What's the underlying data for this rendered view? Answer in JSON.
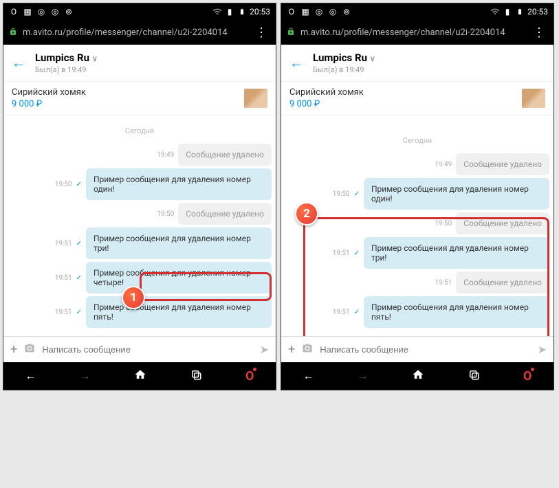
{
  "status": {
    "time": "20:53"
  },
  "browser": {
    "url": "m.avito.ru/profile/messenger/channel/u2i-2204014"
  },
  "header": {
    "contact_name": "Lumpics Ru",
    "last_seen": "Был(а) в 19:49"
  },
  "listing": {
    "title": "Сирийский хомяк",
    "price": "9 000 ₽"
  },
  "chat": {
    "date_label": "Сегодня",
    "deleted_text": "Сообщение удалено",
    "left_messages": [
      {
        "time": "19:49",
        "deleted": true
      },
      {
        "time": "19:50",
        "text": "Пример сообщения для удаления номер один!",
        "check": true
      },
      {
        "time": "19:50",
        "deleted": true
      },
      {
        "time": "19:51",
        "text": "Пример сообщения для удаления номер три!",
        "check": true
      },
      {
        "time": "19:51",
        "text": "Пример сообщения для удаления номер четыре!",
        "check": true
      },
      {
        "time": "19:51",
        "text": "Пример сообщения для удаления номер пять!",
        "check": true
      }
    ],
    "right_messages": [
      {
        "time": "19:49",
        "deleted": true
      },
      {
        "time": "19:50",
        "text": "Пример сообщения для удаления номер один!",
        "check": true
      },
      {
        "time": "19:50",
        "deleted": true
      },
      {
        "time": "19:51",
        "text": "Пример сообщения для удаления номер три!",
        "check": true
      },
      {
        "time": "19:51",
        "deleted": true
      },
      {
        "time": "19:51",
        "text": "Пример сообщения для удаления номер пять!",
        "check": true
      }
    ]
  },
  "input": {
    "placeholder": "Написать сообщение"
  },
  "callouts": {
    "one": "1",
    "two": "2"
  }
}
